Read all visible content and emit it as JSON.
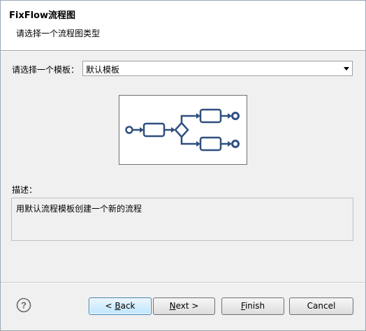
{
  "header": {
    "title": "FixFlow流程图",
    "subtitle": "请选择一个流程图类型"
  },
  "template": {
    "label": "请选择一个模板：",
    "selected": "默认模板"
  },
  "description": {
    "label": "描述：",
    "text": "用默认流程模板创建一个新的流程"
  },
  "buttons": {
    "back_prefix": "< ",
    "back_mnemonic": "B",
    "back_rest": "ack",
    "next_mnemonic": "N",
    "next_rest": "ext >",
    "finish_mnemonic": "F",
    "finish_rest": "inish",
    "cancel": "Cancel"
  },
  "colors": {
    "diagram_stroke": "#2f4f7f",
    "default_button_border": "#3c7fb1"
  },
  "icons": [
    "help-icon",
    "dropdown-arrow-icon"
  ]
}
